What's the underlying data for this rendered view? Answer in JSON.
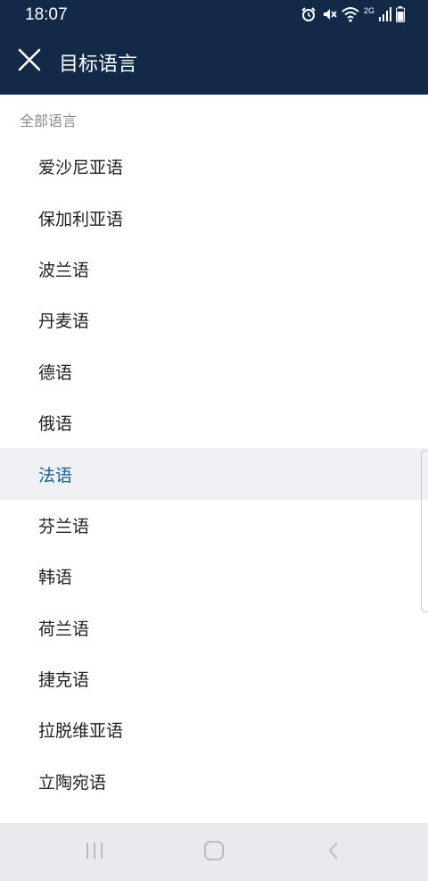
{
  "status_bar": {
    "time": "18:07",
    "icons": [
      "alarm-icon",
      "mute-icon",
      "wifi-icon",
      "network-2g-icon",
      "signal-icon",
      "battery-icon"
    ],
    "network_label": "2G"
  },
  "app_bar": {
    "title": "目标语言",
    "close_icon": "close-icon"
  },
  "section": {
    "header": "全部语言"
  },
  "languages": [
    {
      "label": "爱沙尼亚语"
    },
    {
      "label": "保加利亚语"
    },
    {
      "label": "波兰语"
    },
    {
      "label": "丹麦语"
    },
    {
      "label": "德语"
    },
    {
      "label": "俄语"
    },
    {
      "label": "法语"
    },
    {
      "label": "芬兰语"
    },
    {
      "label": "韩语"
    },
    {
      "label": "荷兰语"
    },
    {
      "label": "捷克语"
    },
    {
      "label": "拉脱维亚语"
    },
    {
      "label": "立陶宛语"
    }
  ],
  "selected_language": "法语",
  "nav_bar": {
    "icons": [
      "recent-apps-icon",
      "home-icon",
      "back-icon"
    ]
  },
  "colors": {
    "header_bg": "#122a47",
    "selected_text": "#1b5d8c",
    "selected_bg": "#f0f1f4",
    "section_header": "#858b92",
    "navbar_bg": "#e9eaee"
  }
}
